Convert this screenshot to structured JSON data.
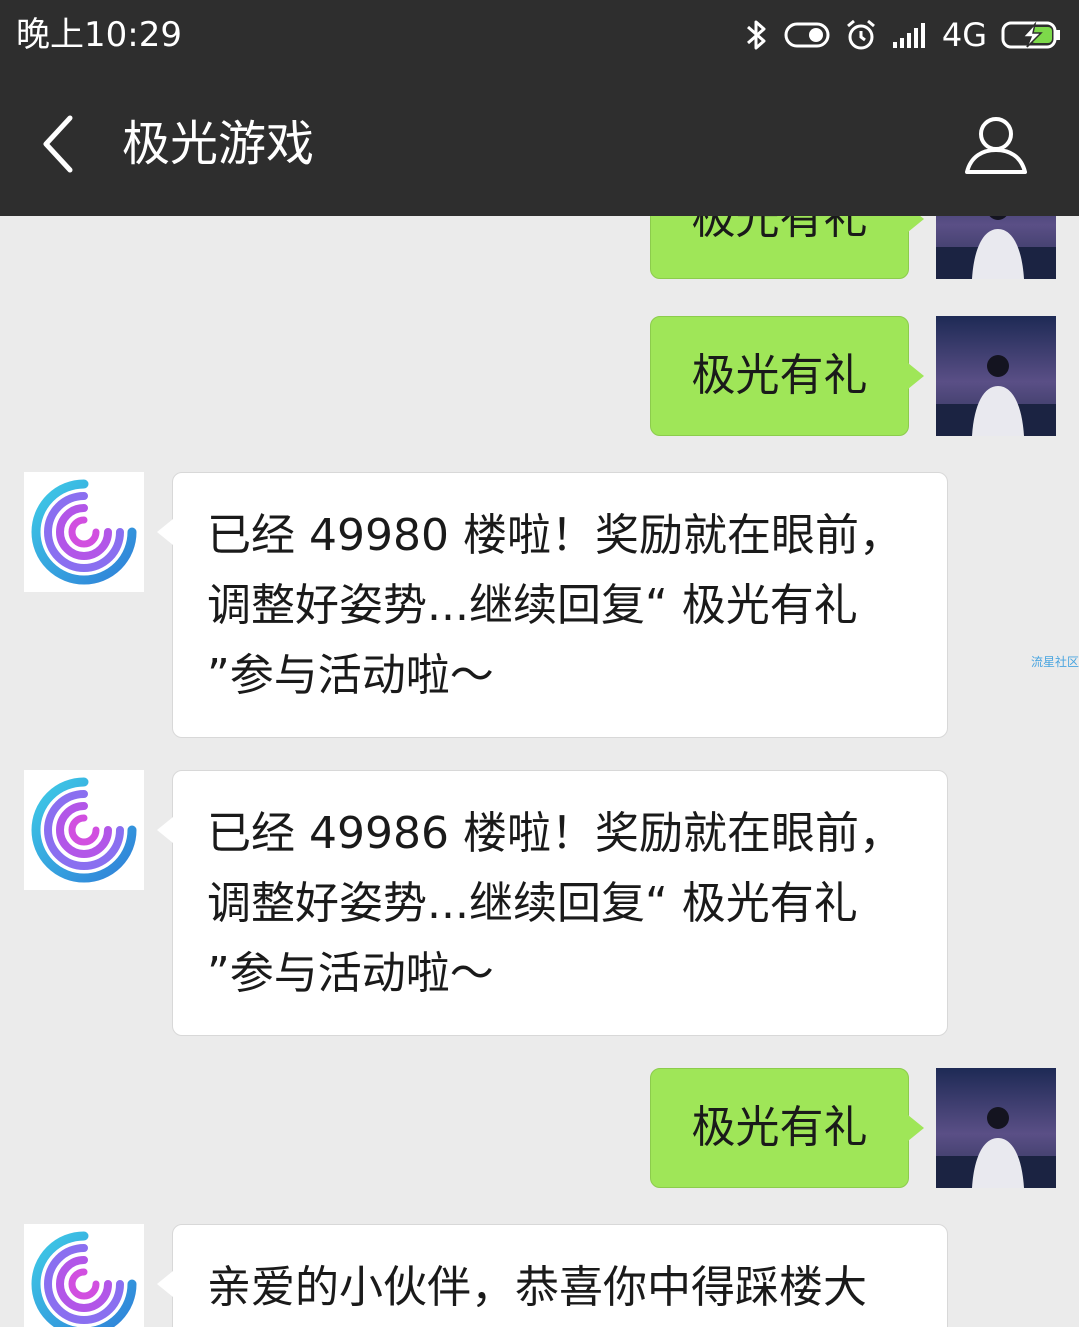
{
  "status_bar": {
    "time": "晚上10:29",
    "network": "4G",
    "icons": [
      "bluetooth-icon",
      "toggle-icon",
      "alarm-icon",
      "signal-icon",
      "battery-charging-icon"
    ]
  },
  "header": {
    "back_icon": "chevron-left-icon",
    "title": "极光游戏",
    "profile_icon": "user-icon"
  },
  "messages": [
    {
      "side": "out",
      "text": "极光有礼"
    },
    {
      "side": "out",
      "text": "极光有礼"
    },
    {
      "side": "in",
      "text": "已经 49980 楼啦！奖励就在眼前，调整好姿势...继续回复“ 极光有礼 ”参与活动啦～"
    },
    {
      "side": "in",
      "text": "已经 49986 楼啦！奖励就在眼前，调整好姿势...继续回复“ 极光有礼 ”参与活动啦～"
    },
    {
      "side": "out",
      "text": "极光有礼"
    },
    {
      "side": "in",
      "text": "亲爱的小伙伴，恭喜你中得踩楼大"
    }
  ],
  "watermark": "流星社区",
  "colors": {
    "header_bg": "#2e2e2e",
    "chat_bg": "#ebebeb",
    "outgoing_bubble": "#9fe658",
    "incoming_bubble": "#ffffff"
  }
}
